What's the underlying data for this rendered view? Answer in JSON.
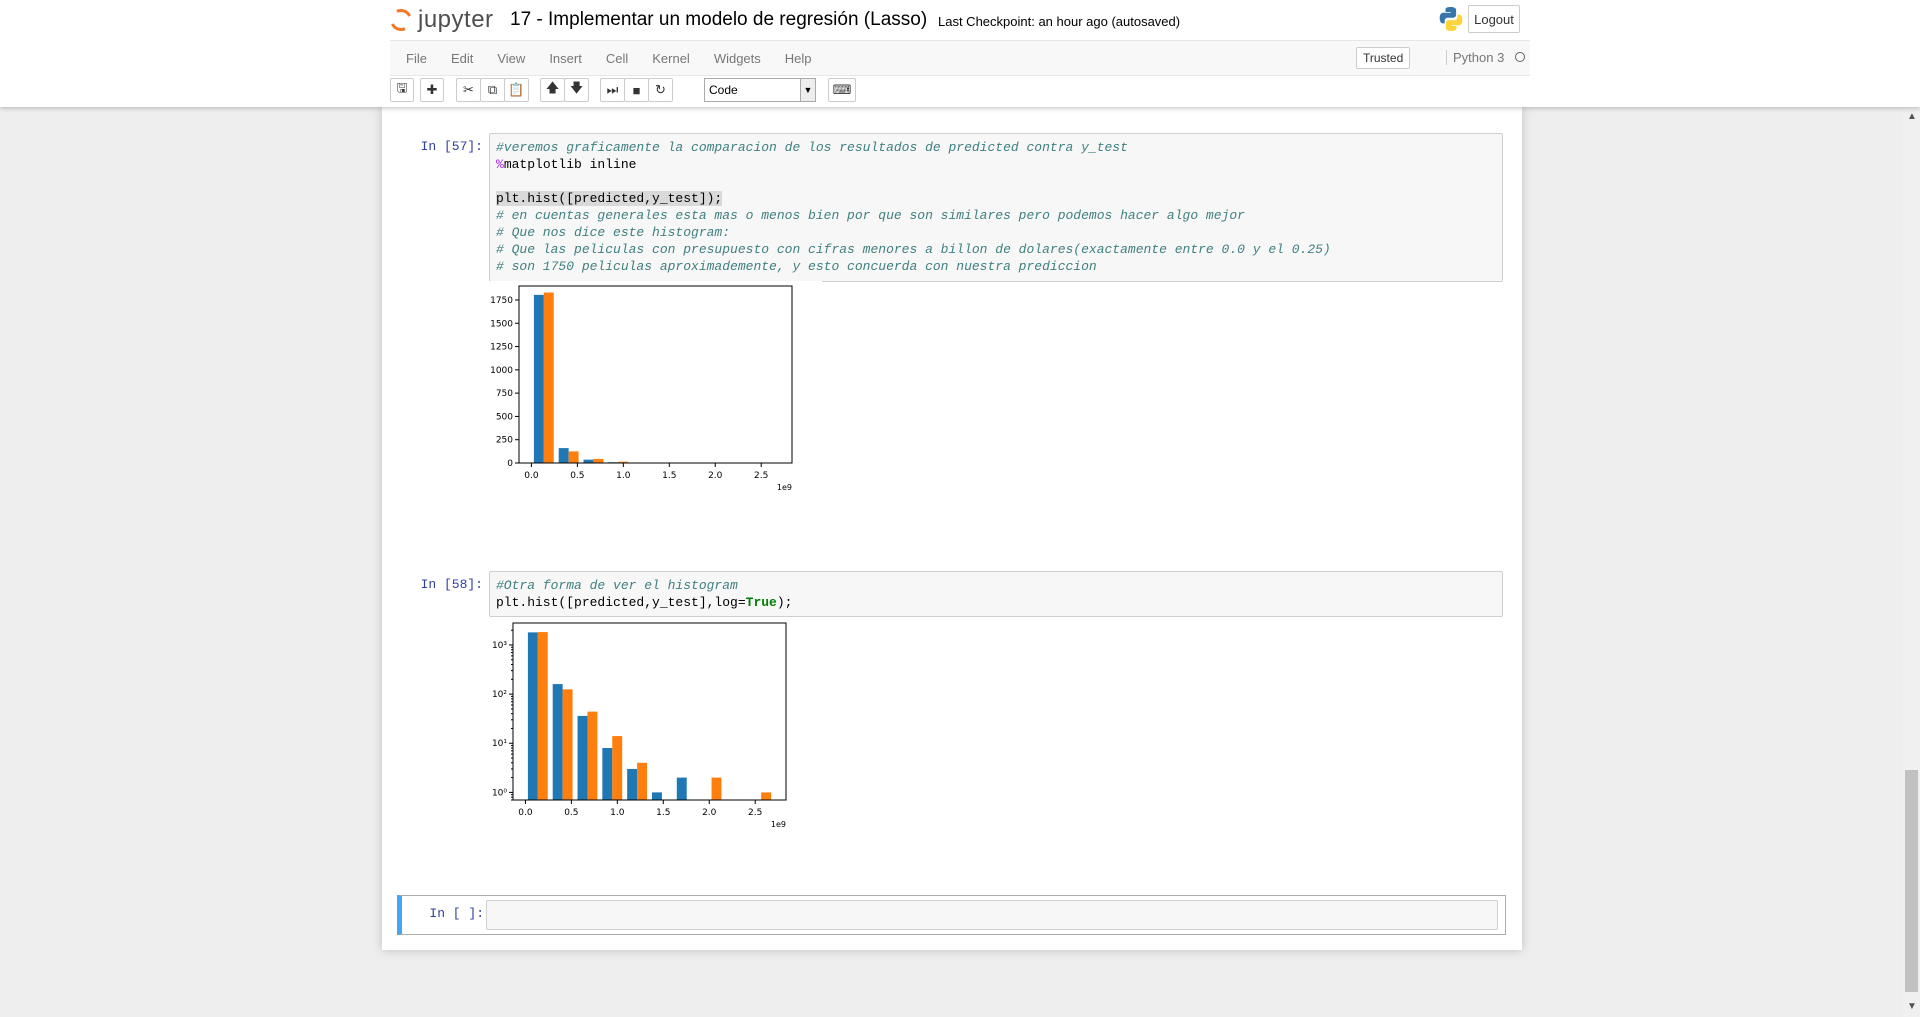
{
  "header": {
    "logo_text": "jupyter",
    "notebook_name": "17 - Implementar un modelo de regresión (Lasso)",
    "checkpoint_text": "Last Checkpoint: an hour ago (autosaved)",
    "logout_label": "Logout"
  },
  "menubar": {
    "items": [
      "File",
      "Edit",
      "View",
      "Insert",
      "Cell",
      "Kernel",
      "Widgets",
      "Help"
    ],
    "trusted_label": "Trusted",
    "kernel_name": "Python 3"
  },
  "toolbar": {
    "icons": [
      "save-icon",
      "plus-icon",
      "cut-icon",
      "copy-icon",
      "paste-icon",
      "move-up-icon",
      "move-down-icon",
      "run-icon",
      "stop-icon",
      "restart-icon"
    ],
    "cell_type": "Code",
    "keyboard_icon": "keyboard-icon"
  },
  "cells": [
    {
      "prompt": "In [57]:",
      "lines": [
        "#veremos graficamente la comparacion de los resultados de predicted contra y_test",
        "%matplotlib inline",
        "",
        "plt.hist([predicted,y_test]);",
        "# en cuentas generales esta mas o menos bien por que son similares pero podemos hacer algo mejor",
        "# Que nos dice este histogram:",
        "# Que las peliculas con presupuesto con cifras menores a billon de dolares(exactamente entre 0.0 y el 0.25)",
        "# son 1750 peliculas aproximademente, y esto concuerda con nuestra prediccion"
      ]
    },
    {
      "prompt": "In [58]:",
      "lines": [
        "#Otra forma de ver el histogram",
        "plt.hist([predicted,y_test],log=True);"
      ]
    },
    {
      "prompt": "In [ ]:",
      "lines": []
    }
  ],
  "chart_data": [
    {
      "type": "bar",
      "title": "",
      "xlabel": "",
      "ylabel": "",
      "x_offset_label": "1e9",
      "x_bin_edges": [
        0,
        0.27,
        0.54,
        0.81,
        1.08,
        1.35,
        1.62,
        1.89,
        2.16,
        2.43,
        2.7
      ],
      "xticks": [
        "0.0",
        "0.5",
        "1.0",
        "1.5",
        "2.0",
        "2.5"
      ],
      "yticks": [
        "0",
        "250",
        "500",
        "750",
        "1000",
        "1250",
        "1500",
        "1750"
      ],
      "ylim": [
        0,
        1900
      ],
      "xlim": [
        -0.135,
        2.835
      ],
      "series": [
        {
          "color": "#1f77b4",
          "values": [
            1805,
            160,
            36,
            8,
            3,
            1,
            2,
            0,
            0,
            0
          ]
        },
        {
          "color": "#ff7f0e",
          "values": [
            1830,
            125,
            44,
            14,
            4,
            0,
            0,
            2,
            0,
            1
          ]
        }
      ]
    },
    {
      "type": "bar",
      "title": "",
      "xlabel": "",
      "ylabel": "",
      "yscale": "log",
      "x_offset_label": "1e9",
      "x_bin_edges": [
        0,
        0.27,
        0.54,
        0.81,
        1.08,
        1.35,
        1.62,
        1.89,
        2.16,
        2.43,
        2.7
      ],
      "xticks": [
        "0.0",
        "0.5",
        "1.0",
        "1.5",
        "2.0",
        "2.5"
      ],
      "yticks": [
        "10⁰",
        "10¹",
        "10²",
        "10³"
      ],
      "ylim": [
        0.7,
        2800
      ],
      "xlim": [
        -0.135,
        2.835
      ],
      "series": [
        {
          "color": "#1f77b4",
          "values": [
            1805,
            160,
            36,
            8,
            3,
            1,
            2,
            0,
            0,
            0
          ]
        },
        {
          "color": "#ff7f0e",
          "values": [
            1830,
            125,
            44,
            14,
            4,
            0,
            0,
            2,
            0,
            1
          ]
        }
      ]
    }
  ]
}
